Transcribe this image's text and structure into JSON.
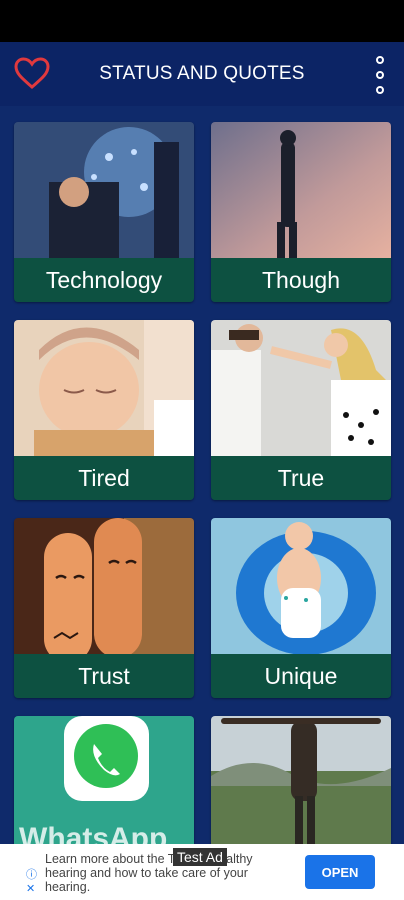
{
  "app": {
    "title": "STATUS AND QUOTES"
  },
  "categories": [
    {
      "label": "Technology"
    },
    {
      "label": "Though"
    },
    {
      "label": "Tired"
    },
    {
      "label": "True"
    },
    {
      "label": "Trust"
    },
    {
      "label": "Unique"
    },
    {
      "label": ""
    },
    {
      "label": ""
    }
  ],
  "ad": {
    "badge": "Test Ad",
    "text": "Learn more about the Test Ad healthy hearing and how to take care of your hearing.",
    "cta": "OPEN",
    "info_icon": "info-icon",
    "close_icon": "close-icon"
  },
  "colors": {
    "background": "#0f2a6b",
    "app_bar": "#0c2465",
    "card_label": "#0d5141",
    "heart": "#e0393e",
    "ad_button": "#1a73e8"
  }
}
